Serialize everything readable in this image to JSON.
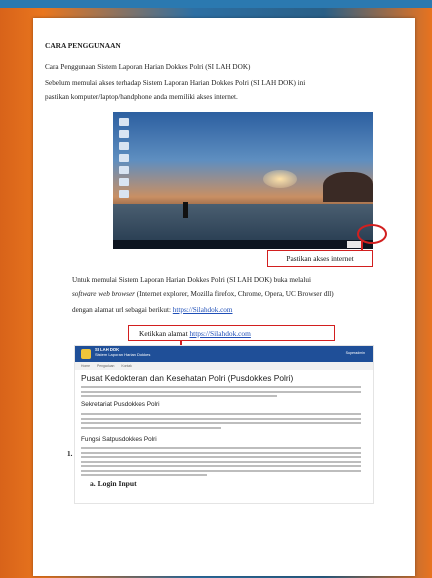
{
  "document": {
    "heading": "CARA PENGGUNAAN",
    "intro_line1": "Cara Penggunaan Sistem Laporan Harian Dokkes Polri (SI LAH DOK)",
    "intro_line2": "Sebelum memulai akses terhadap Sistem Laporan Harian Dokkes Polri (SI LAH DOK) ini",
    "intro_line3": "pastikan komputer/laptop/handphone  anda memiliki akses internet.",
    "callout_internet": "Pastikan akses internet",
    "body_line1": "Untuk  memulai  Sistem  Laporan  Harian  Dokkes  Polri  (SI LAH  DOK)  buka  melalui",
    "body_line2_italic": "software web browser",
    "body_line2_rest": " (Internet explorer, Mozilla firefox, Chrome, Opera, UC Browser dll)",
    "body_line3_prefix": "dengan alamat url sebagai berikut: ",
    "url": "https://Silahdok.com",
    "callout_url_prefix": "Ketikkan  alamat  ",
    "list_number": "1.",
    "sub_item": "a.    Login Input"
  },
  "website": {
    "brand_name": "SI LAH DOK",
    "brand_sub": "Sistem Laporan Harian Dokkes",
    "top_right": "Superadmin",
    "nav": [
      "Home",
      "Pengaduan",
      "Kontak"
    ],
    "title": "Pusat Kedokteran dan Kesehatan Polri (Pusdokkes Polri)",
    "section1": "Sekretariat Pusdokkes Polri",
    "section2": "Fungsi Satpusdokkes Polri"
  },
  "colors": {
    "accent_red": "#d21f1f",
    "link_blue": "#1f4fb8",
    "site_header": "#1f4f98"
  }
}
